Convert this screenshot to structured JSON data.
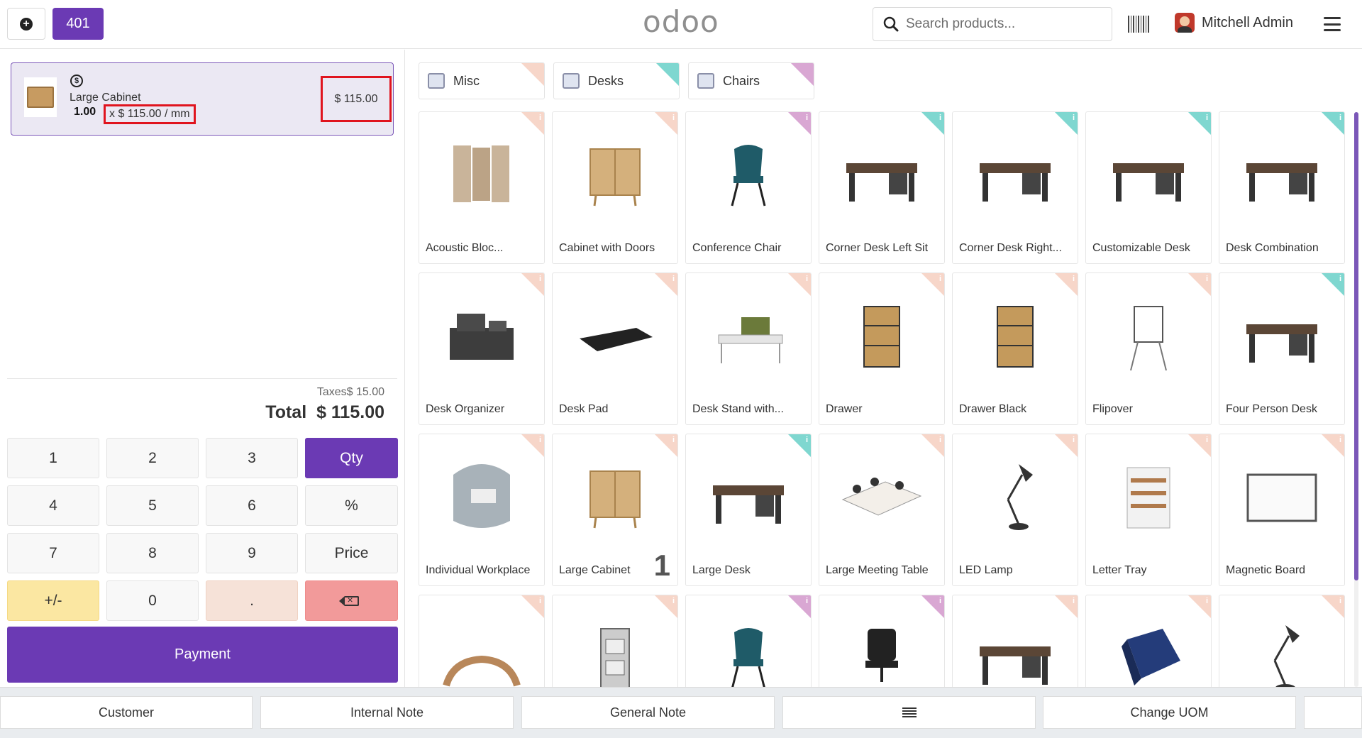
{
  "header": {
    "order_number": "401",
    "logo": "odoo",
    "search_placeholder": "Search products...",
    "user_name": "Mitchell Admin"
  },
  "order": {
    "lines": [
      {
        "product": "Large Cabinet",
        "quantity": "1.00",
        "unit_price": "x $ 115.00 / mm",
        "price": "$ 115.00"
      }
    ],
    "taxes_label": "Taxes",
    "taxes_value": "$ 15.00",
    "total_label": "Total",
    "total_value": "$ 115.00"
  },
  "numpad": {
    "keys": [
      "1",
      "2",
      "3",
      "Qty",
      "4",
      "5",
      "6",
      "%",
      "7",
      "8",
      "9",
      "Price",
      "+/-",
      "0",
      "."
    ],
    "payment_label": "Payment"
  },
  "categories": [
    {
      "label": "Misc",
      "color": "#f7d6c9"
    },
    {
      "label": "Desks",
      "color": "#7fd7d0"
    },
    {
      "label": "Chairs",
      "color": "#d9a7d3"
    }
  ],
  "products": [
    {
      "name": "Acoustic Bloc...",
      "color": "#f7d6c9",
      "icon": "acoustic-screen-icon"
    },
    {
      "name": "Cabinet with Doors",
      "color": "#f7d6c9",
      "icon": "cabinet-icon"
    },
    {
      "name": "Conference Chair",
      "color": "#d9a7d3",
      "icon": "chair-icon"
    },
    {
      "name": "Corner Desk Left Sit",
      "color": "#7fd7d0",
      "icon": "desk-icon"
    },
    {
      "name": "Corner Desk Right...",
      "color": "#7fd7d0",
      "icon": "desk-icon"
    },
    {
      "name": "Customizable Desk",
      "color": "#7fd7d0",
      "icon": "desk-icon"
    },
    {
      "name": "Desk Combination",
      "color": "#7fd7d0",
      "icon": "desk-icon"
    },
    {
      "name": "Desk Organizer",
      "color": "#f7d6c9",
      "icon": "organizer-icon"
    },
    {
      "name": "Desk Pad",
      "color": "#f7d6c9",
      "icon": "pad-icon"
    },
    {
      "name": "Desk Stand with...",
      "color": "#f7d6c9",
      "icon": "desk-stand-icon"
    },
    {
      "name": "Drawer",
      "color": "#f7d6c9",
      "icon": "drawer-icon"
    },
    {
      "name": "Drawer Black",
      "color": "#f7d6c9",
      "icon": "drawer-icon"
    },
    {
      "name": "Flipover",
      "color": "#f7d6c9",
      "icon": "flipover-icon"
    },
    {
      "name": "Four Person Desk",
      "color": "#7fd7d0",
      "icon": "desk-icon"
    },
    {
      "name": "Individual Workplace",
      "color": "#f7d6c9",
      "icon": "workplace-icon"
    },
    {
      "name": "Large Cabinet",
      "color": "#f7d6c9",
      "icon": "cabinet-icon",
      "qty": "1"
    },
    {
      "name": "Large Desk",
      "color": "#7fd7d0",
      "icon": "desk-icon"
    },
    {
      "name": "Large Meeting Table",
      "color": "#f7d6c9",
      "icon": "table-icon"
    },
    {
      "name": "LED Lamp",
      "color": "#f7d6c9",
      "icon": "lamp-icon"
    },
    {
      "name": "Letter Tray",
      "color": "#f7d6c9",
      "icon": "tray-icon"
    },
    {
      "name": "Magnetic Board",
      "color": "#f7d6c9",
      "icon": "board-icon"
    },
    {
      "name": "",
      "color": "#f7d6c9",
      "icon": "stand-icon"
    },
    {
      "name": "",
      "color": "#f7d6c9",
      "icon": "file-cabinet-icon"
    },
    {
      "name": "",
      "color": "#d9a7d3",
      "icon": "chair-icon"
    },
    {
      "name": "",
      "color": "#d9a7d3",
      "icon": "office-chair-icon"
    },
    {
      "name": "",
      "color": "#f7d6c9",
      "icon": "desk-icon"
    },
    {
      "name": "",
      "color": "#f7d6c9",
      "icon": "software-box-icon"
    },
    {
      "name": "",
      "color": "#f7d6c9",
      "icon": "lamp-icon"
    }
  ],
  "control_buttons": {
    "customer": "Customer",
    "internal_note": "Internal Note",
    "general_note": "General Note",
    "change_uom": "Change UOM"
  }
}
